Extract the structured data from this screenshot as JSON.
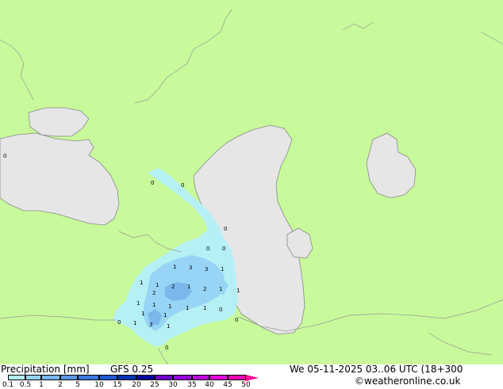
{
  "footer": {
    "title": "Precipitation [mm]",
    "model": "GFS 0.25",
    "valid": "We 05-11-2025 03..06 UTC (18+300",
    "credit": "©weatheronline.co.uk"
  },
  "legend": {
    "ticks": [
      "0.1",
      "0.5",
      "1",
      "2",
      "5",
      "10",
      "15",
      "20",
      "25",
      "30",
      "35",
      "40",
      "45",
      "50"
    ],
    "colors": [
      "#b4f0fa",
      "#96d2fa",
      "#78b4f0",
      "#5a96e6",
      "#3c78dc",
      "#1e5ad2",
      "#0032b4",
      "#0000a0",
      "#6e00c8",
      "#9600dc",
      "#be00dc",
      "#e600dc",
      "#f000b4",
      "#ff0096"
    ]
  },
  "map": {
    "land_color": "#c8fa9b",
    "sea_color": "#e6e6e6",
    "precip_light": "#b4f0fa",
    "precip_medium": "#96d2fa",
    "precip_heavy": "#5aa0e6",
    "labels": [
      "0",
      "0",
      "0",
      "0",
      "0",
      "0",
      "0",
      "1",
      "3",
      "3",
      "1",
      "1",
      "1",
      "2",
      "1",
      "2",
      "1",
      "1",
      "1",
      "1",
      "1",
      "1",
      "1",
      "1",
      "3",
      "1",
      "0",
      "0",
      "0",
      "2",
      "1",
      "1"
    ]
  }
}
